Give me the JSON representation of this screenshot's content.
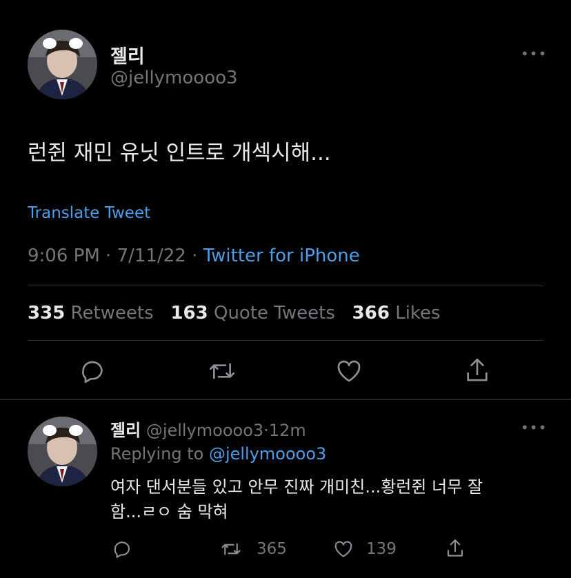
{
  "main_tweet": {
    "display_name": "젤리",
    "handle": "@jellymoooo3",
    "more_label": "•••",
    "text": "런쥔 재민 유닛 인트로 개섹시해...",
    "translate_label": "Translate Tweet",
    "time": "9:06 PM",
    "separator1": "·",
    "date": "7/11/22",
    "separator2": "·",
    "source": "Twitter for iPhone",
    "stats": [
      {
        "num": "335",
        "label": "Retweets"
      },
      {
        "num": "163",
        "label": "Quote Tweets"
      },
      {
        "num": "366",
        "label": "Likes"
      }
    ],
    "actions": [
      "reply-icon",
      "retweet-icon",
      "like-icon",
      "share-icon"
    ]
  },
  "reply": {
    "display_name": "젤리",
    "handle": "@jellymoooo3",
    "separator": "·",
    "age": "12m",
    "more_label": "•••",
    "replying_prefix": "Replying to",
    "replying_to": "@jellymoooo3",
    "text_line1": "여자 댄서분들 있고 안무 진짜 개미친...황런쥔 너무 잘",
    "text_line2": "함...ㄹㅇ 숨 막혀",
    "retweet_count": "365",
    "like_count": "139"
  },
  "colors": {
    "background": "#000000",
    "text": "#e7e9ea",
    "muted": "#71767b",
    "link": "#4c9eeb",
    "divider": "#2f3336"
  }
}
